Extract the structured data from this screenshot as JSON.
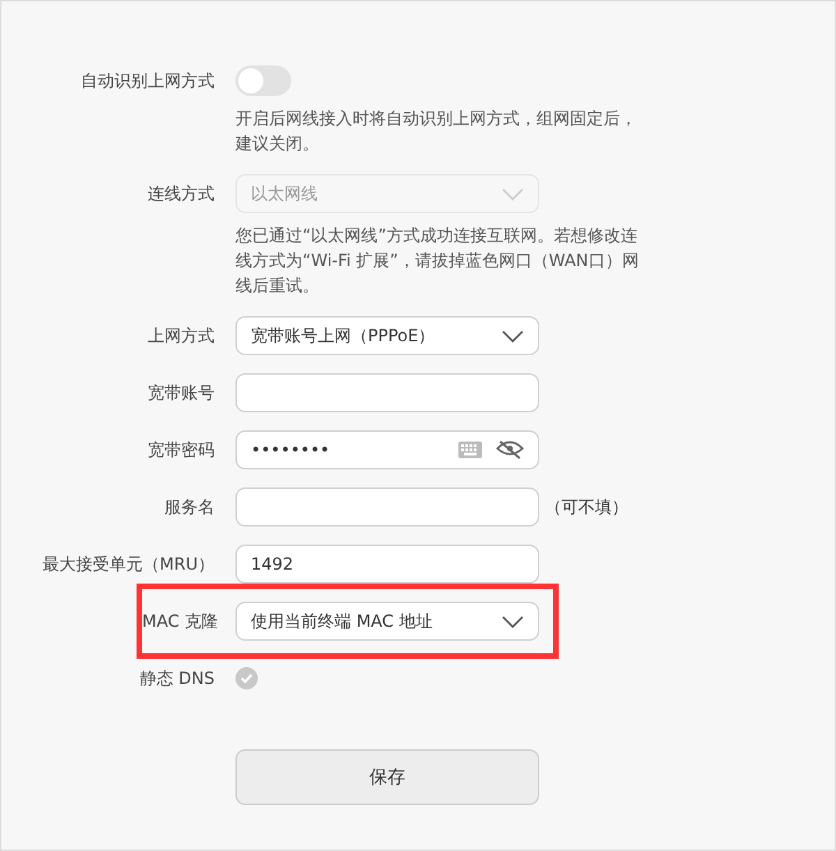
{
  "fields": [
    {
      "kind": "toggle",
      "label": "自动识别上网方式",
      "on": false,
      "hint": "开启后网线接入时将自动识别上网方式，组网固定后，建议关闭。"
    },
    {
      "kind": "select",
      "label": "连线方式",
      "value": "以太网线",
      "disabled": true,
      "highlighted": false,
      "hint": "您已通过“以太网线”方式成功连接互联网。若想修改连线方式为“Wi-Fi 扩展”，请拔掉蓝色网口（WAN口）网线后重试。"
    },
    {
      "kind": "select",
      "label": "上网方式",
      "value": "宽带账号上网（PPPoE）",
      "disabled": false,
      "highlighted": false
    },
    {
      "kind": "text",
      "label": "宽带账号"
    },
    {
      "kind": "password",
      "label": "宽带密码",
      "value": "••••••••"
    },
    {
      "kind": "text",
      "label": "服务名",
      "suffix": "（可不填）"
    },
    {
      "kind": "text",
      "label": "最大接受单元（MRU）",
      "value": "1492"
    },
    {
      "kind": "select",
      "label": "MAC 克隆",
      "value": "使用当前终端 MAC 地址",
      "disabled": false,
      "highlighted": true
    },
    {
      "kind": "check",
      "label": "静态 DNS",
      "checked": true
    }
  ],
  "save_button": "保存"
}
